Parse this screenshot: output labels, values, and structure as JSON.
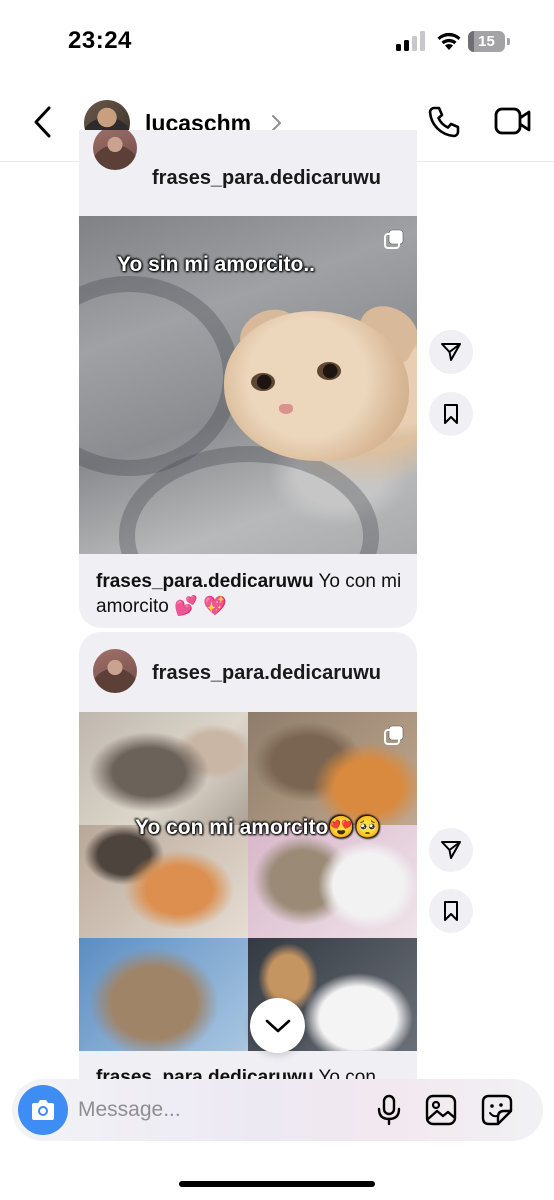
{
  "status_bar": {
    "time": "23:24",
    "battery": "15",
    "battery_level": 0.15
  },
  "header": {
    "username": "lucaschm_",
    "icons": [
      "back-chevron-icon",
      "chevron-right-icon",
      "phone-icon",
      "video-camera-icon"
    ]
  },
  "posts": [
    {
      "author": "frases_para.dedicaruwu",
      "overlay_text": "Yo sin mi amorcito..",
      "caption_author": "frases_para.dedicaruwu",
      "caption_text": " Yo con mi amorcito 💕 💖"
    },
    {
      "author": "frases_para.dedicaruwu",
      "overlay_text": "Yo con mi amorcito😍🥺",
      "caption_author": "frases_para.dedicaruwu",
      "caption_text": " Yo con"
    }
  ],
  "composer": {
    "placeholder": "Message...",
    "icons": [
      "camera-icon",
      "microphone-icon",
      "gallery-icon",
      "sticker-icon"
    ]
  },
  "colors": {
    "accent": "#3d8df5",
    "card_bg": "#efeff4"
  }
}
